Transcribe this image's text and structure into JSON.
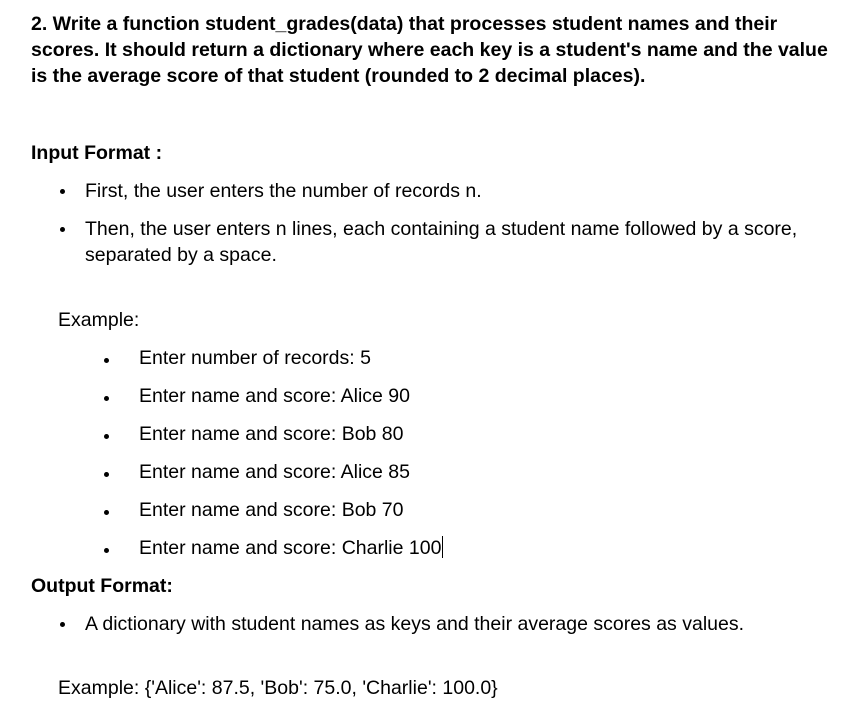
{
  "question": "2. Write a function student_grades(data) that processes student names and their scores. It should return a dictionary where each key is a student's name and the value is the average score of that student (rounded to 2 decimal places).",
  "input_format": {
    "heading": "Input Format :",
    "items": [
      "First, the user enters the number of records n.",
      "Then, the user enters n lines, each containing a student name followed by a score, separated by a space."
    ]
  },
  "example": {
    "label": "Example:",
    "items": [
      "Enter number of records: 5",
      "Enter name and score: Alice 90",
      "Enter name and score: Bob 80",
      "Enter name and score: Alice 85",
      "Enter name and score: Bob 70",
      "Enter name and score: Charlie 100"
    ]
  },
  "output_format": {
    "heading": "Output Format:",
    "items": [
      "A dictionary with student names as keys and their average scores as values."
    ]
  },
  "output_example": "Example: {'Alice': 87.5, 'Bob': 75.0, 'Charlie': 100.0}"
}
